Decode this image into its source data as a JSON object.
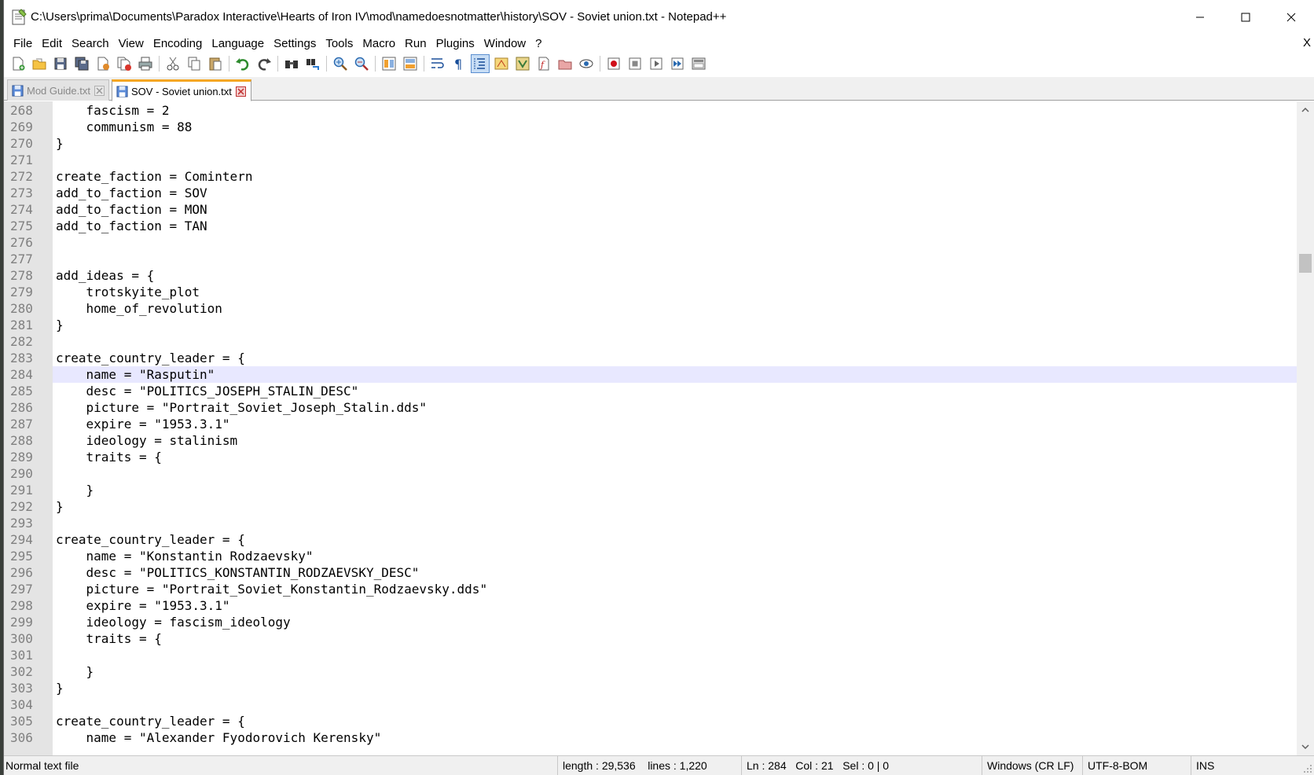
{
  "window": {
    "title": "C:\\Users\\prima\\Documents\\Paradox Interactive\\Hearts of Iron IV\\mod\\namedoesnotmatter\\history\\SOV - Soviet union.txt - Notepad++"
  },
  "menu": {
    "items": [
      "File",
      "Edit",
      "Search",
      "View",
      "Encoding",
      "Language",
      "Settings",
      "Tools",
      "Macro",
      "Run",
      "Plugins",
      "Window",
      "?"
    ],
    "close_label": "X"
  },
  "toolbar": {
    "icons": [
      "new-file",
      "open-file",
      "save",
      "save-all",
      "close",
      "close-all",
      "print",
      "cut",
      "copy",
      "paste",
      "undo",
      "redo",
      "find",
      "replace",
      "zoom-in",
      "zoom-out",
      "sync-vertical",
      "sync-horizontal",
      "word-wrap",
      "show-all-characters",
      "indent-guide",
      "udl",
      "doc-map",
      "function-list",
      "folder-workspace",
      "monitoring",
      "record-macro",
      "stop-macro",
      "play-macro",
      "run-macro-multiple",
      "save-macro"
    ],
    "active_icon": "indent-guide"
  },
  "tabs": [
    {
      "label": "Mod Guide.txt",
      "active": false
    },
    {
      "label": "SOV - Soviet union.txt",
      "active": true
    }
  ],
  "editor": {
    "current_line": 284,
    "lines": [
      {
        "n": "268",
        "text": "    fascism = 2"
      },
      {
        "n": "269",
        "text": "    communism = 88"
      },
      {
        "n": "270",
        "text": "}"
      },
      {
        "n": "271",
        "text": ""
      },
      {
        "n": "272",
        "text": "create_faction = Comintern"
      },
      {
        "n": "273",
        "text": "add_to_faction = SOV"
      },
      {
        "n": "274",
        "text": "add_to_faction = MON"
      },
      {
        "n": "275",
        "text": "add_to_faction = TAN"
      },
      {
        "n": "276",
        "text": ""
      },
      {
        "n": "277",
        "text": ""
      },
      {
        "n": "278",
        "text": "add_ideas = {"
      },
      {
        "n": "279",
        "text": "    trotskyite_plot"
      },
      {
        "n": "280",
        "text": "    home_of_revolution"
      },
      {
        "n": "281",
        "text": "}"
      },
      {
        "n": "282",
        "text": ""
      },
      {
        "n": "283",
        "text": "create_country_leader = {"
      },
      {
        "n": "284",
        "text": "    name = \"Rasputin\""
      },
      {
        "n": "285",
        "text": "    desc = \"POLITICS_JOSEPH_STALIN_DESC\""
      },
      {
        "n": "286",
        "text": "    picture = \"Portrait_Soviet_Joseph_Stalin.dds\""
      },
      {
        "n": "287",
        "text": "    expire = \"1953.3.1\""
      },
      {
        "n": "288",
        "text": "    ideology = stalinism"
      },
      {
        "n": "289",
        "text": "    traits = {"
      },
      {
        "n": "290",
        "text": ""
      },
      {
        "n": "291",
        "text": "    }"
      },
      {
        "n": "292",
        "text": "}"
      },
      {
        "n": "293",
        "text": ""
      },
      {
        "n": "294",
        "text": "create_country_leader = {"
      },
      {
        "n": "295",
        "text": "    name = \"Konstantin Rodzaevsky\""
      },
      {
        "n": "296",
        "text": "    desc = \"POLITICS_KONSTANTIN_RODZAEVSKY_DESC\""
      },
      {
        "n": "297",
        "text": "    picture = \"Portrait_Soviet_Konstantin_Rodzaevsky.dds\""
      },
      {
        "n": "298",
        "text": "    expire = \"1953.3.1\""
      },
      {
        "n": "299",
        "text": "    ideology = fascism_ideology"
      },
      {
        "n": "300",
        "text": "    traits = {"
      },
      {
        "n": "301",
        "text": ""
      },
      {
        "n": "302",
        "text": "    }"
      },
      {
        "n": "303",
        "text": "}"
      },
      {
        "n": "304",
        "text": ""
      },
      {
        "n": "305",
        "text": "create_country_leader = {"
      },
      {
        "n": "306",
        "text": "    name = \"Alexander Fyodorovich Kerensky\""
      }
    ]
  },
  "status": {
    "file_type": "Normal text file",
    "length": "length : 29,536",
    "lines": "lines : 1,220",
    "ln": "Ln : 284",
    "col": "Col : 21",
    "sel": "Sel : 0 | 0",
    "eol": "Windows (CR LF)",
    "encoding": "UTF-8-BOM",
    "mode": "INS"
  }
}
